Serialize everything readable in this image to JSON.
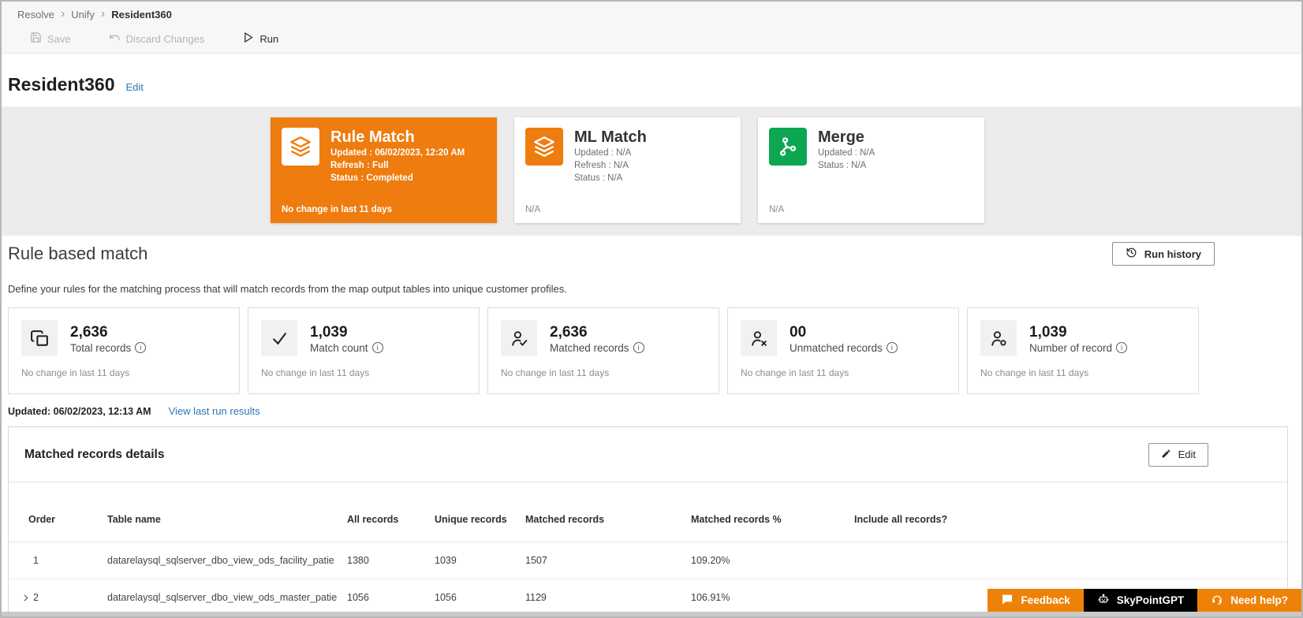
{
  "breadcrumb": {
    "items": [
      {
        "label": "Resolve"
      },
      {
        "label": "Unify"
      },
      {
        "label": "Resident360"
      }
    ]
  },
  "toolbar": {
    "save_label": "Save",
    "discard_label": "Discard Changes",
    "run_label": "Run"
  },
  "page": {
    "title": "Resident360",
    "edit_link": "Edit"
  },
  "pipeline_cards": [
    {
      "title": "Rule Match",
      "updated": "Updated : 06/02/2023, 12:20 AM",
      "refresh": "Refresh : Full",
      "status": "Status : Completed",
      "footer": "No change in last 11 days",
      "icon": "layers-icon"
    },
    {
      "title": "ML Match",
      "updated": "Updated : N/A",
      "refresh": "Refresh : N/A",
      "status": "Status : N/A",
      "footer": "N/A",
      "icon": "layers-icon"
    },
    {
      "title": "Merge",
      "updated": "Updated : N/A",
      "status": "Status : N/A",
      "footer": "N/A",
      "icon": "merge-icon"
    }
  ],
  "rule_section": {
    "title": "Rule based match",
    "run_history_label": "Run history",
    "description": "Define your rules for the matching process that will match records from the map output tables into unique customer profiles."
  },
  "stat_cards": [
    {
      "value": "2,636",
      "label": "Total records",
      "footer": "No change in last 11 days",
      "icon": "records-icon"
    },
    {
      "value": "1,039",
      "label": "Match count",
      "footer": "No change in last 11 days",
      "icon": "check-icon"
    },
    {
      "value": "2,636",
      "label": "Matched records",
      "footer": "No change in last 11 days",
      "icon": "person-check-icon"
    },
    {
      "value": "00",
      "label": "Unmatched records",
      "footer": "No change in last 11 days",
      "icon": "person-x-icon"
    },
    {
      "value": "1,039",
      "label": "Number of record",
      "footer": "No change in last 11 days",
      "icon": "person-search-icon"
    }
  ],
  "last_run": {
    "updated": "Updated: 06/02/2023, 12:13 AM",
    "link": "View last run results"
  },
  "matched_details": {
    "title": "Matched records details",
    "edit_label": "Edit",
    "columns": [
      "Order",
      "Table name",
      "All records",
      "Unique records",
      "Matched records",
      "Matched records %",
      "Include all records?"
    ],
    "rows": [
      {
        "order": "1",
        "table_name": "datarelaysql_sqlserver_dbo_view_ods_facility_patie",
        "all_records": "1380",
        "unique_records": "1039",
        "matched_records": "1507",
        "matched_records_pct": "109.20%",
        "include_all": ""
      },
      {
        "order": "2",
        "table_name": "datarelaysql_sqlserver_dbo_view_ods_master_patie",
        "all_records": "1056",
        "unique_records": "1056",
        "matched_records": "1129",
        "matched_records_pct": "106.91%",
        "include_all": ""
      }
    ]
  },
  "footer_buttons": [
    {
      "label": "Feedback",
      "icon": "chat-icon"
    },
    {
      "label": "SkyPointGPT",
      "icon": "robot-icon"
    },
    {
      "label": "Need help?",
      "icon": "headset-icon"
    }
  ],
  "colors": {
    "accent_orange": "#EE7C0E",
    "footer_orange": "#EE8208",
    "merge_green": "#0CA750",
    "link_blue": "#2E76B5",
    "black_button": "#000000"
  }
}
